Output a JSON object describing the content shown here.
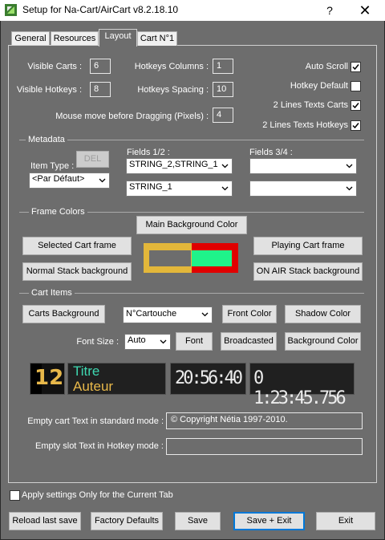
{
  "window": {
    "title": "Setup for Na-Cart/AirCart v8.2.18.10",
    "help": "?",
    "close": "✕"
  },
  "tabs": [
    {
      "label": "General"
    },
    {
      "label": "Resources"
    },
    {
      "label": "Layout"
    },
    {
      "label": "Cart N°1"
    }
  ],
  "layout": {
    "visible_carts_label": "Visible Carts :",
    "visible_carts": "6",
    "visible_hotkeys_label": "Visible Hotkeys :",
    "visible_hotkeys": "8",
    "hotkeys_columns_label": "Hotkeys Columns :",
    "hotkeys_columns": "1",
    "hotkeys_spacing_label": "Hotkeys Spacing :",
    "hotkeys_spacing": "10",
    "mouse_move_label": "Mouse move before Dragging (Pixels) :",
    "mouse_move": "4",
    "auto_scroll_label": "Auto Scroll",
    "auto_scroll": true,
    "hotkey_default_label": "Hotkey Default",
    "hotkey_default": false,
    "two_lines_carts_label": "2 Lines Texts Carts",
    "two_lines_carts": true,
    "two_lines_hotkeys_label": "2 Lines Texts Hotkeys",
    "two_lines_hotkeys": true
  },
  "metadata": {
    "title": "Metadata",
    "item_type_label": "Item Type :",
    "del_button": "DEL",
    "item_type_value": "<Par Défaut>",
    "fields12_label": "Fields 1/2 :",
    "field1_value": "STRING_2,STRING_1",
    "field2_value": "STRING_1",
    "fields34_label": "Fields 3/4 :",
    "field3_value": "",
    "field4_value": ""
  },
  "frame_colors": {
    "title": "Frame Colors",
    "main_bg_button": "Main Background Color",
    "selected_cart_button": "Selected Cart frame",
    "playing_cart_button": "Playing Cart frame",
    "normal_stack_button": "Normal Stack background",
    "onair_stack_button": "ON AIR Stack background",
    "colors": {
      "outer": "#e3b73a",
      "inner_border": "#e00000",
      "left_fill": "#6d6d6d",
      "right_fill": "#1ff38a"
    }
  },
  "cart_items": {
    "title": "Cart Items",
    "carts_bg_button": "Carts Background",
    "cartouche_value": "N°Cartouche",
    "front_color_button": "Front Color",
    "shadow_color_button": "Shadow Color",
    "font_size_label": "Font Size :",
    "font_size_value": "Auto",
    "font_button": "Font",
    "broadcasted_button": "Broadcasted",
    "background_color_button": "Background Color",
    "preview": {
      "number": "12",
      "title": "Titre",
      "author": "Auteur",
      "time": "20:56:40",
      "counter": "0 1:23:45.756",
      "colors": {
        "number": "#e8b84a",
        "title": "#3ed7b0",
        "author": "#e8b84a"
      }
    }
  },
  "empty_texts": {
    "standard_label": "Empty cart Text in standard mode :",
    "standard_value": "© Copyright Nétia 1997-2010.",
    "hotkey_label": "Empty slot Text in Hotkey mode :",
    "hotkey_value": ""
  },
  "apply_only_label": "Apply settings Only for the Current Tab",
  "apply_only": false,
  "buttons": {
    "reload": "Reload last save",
    "factory": "Factory Defaults",
    "save": "Save",
    "save_exit": "Save + Exit",
    "exit": "Exit"
  }
}
